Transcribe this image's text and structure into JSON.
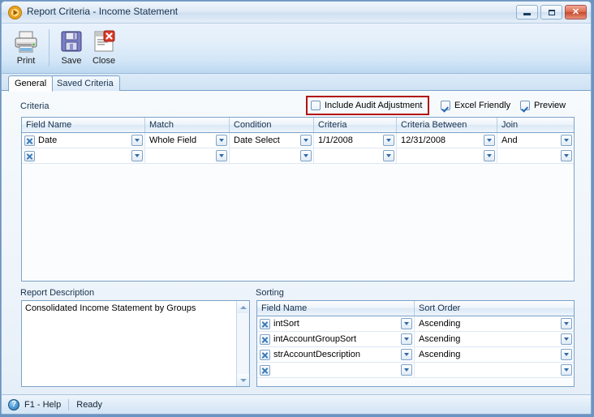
{
  "window": {
    "title": "Report Criteria - Income Statement",
    "app_icon": "play-circle-icon",
    "controls": {
      "minimize": "minimize-button",
      "maximize": "maximize-button",
      "close": "close-button"
    }
  },
  "toolbar": {
    "buttons": [
      {
        "label": "Print",
        "icon": "printer-icon"
      },
      {
        "label": "Save",
        "icon": "floppy-disk-icon"
      },
      {
        "label": "Close",
        "icon": "document-close-icon"
      }
    ]
  },
  "tabs": [
    {
      "label": "General",
      "active": true
    },
    {
      "label": "Saved Criteria",
      "active": false
    }
  ],
  "options": {
    "include_audit_adjustment": {
      "label": "Include Audit Adjustment",
      "checked": false,
      "highlighted": true
    },
    "excel_friendly": {
      "label": "Excel Friendly",
      "checked": true
    },
    "preview": {
      "label": "Preview",
      "checked": true
    }
  },
  "criteria": {
    "group_label": "Criteria",
    "columns": [
      "Field Name",
      "Match",
      "Condition",
      "Criteria",
      "Criteria Between",
      "Join"
    ],
    "rows": [
      {
        "field_name": "Date",
        "match": "Whole Field",
        "condition": "Date Select",
        "criteria": "1/1/2008",
        "criteria_between": "12/31/2008",
        "join": "And"
      },
      {
        "field_name": "",
        "match": "",
        "condition": "",
        "criteria": "",
        "criteria_between": "",
        "join": ""
      }
    ]
  },
  "report_description": {
    "label": "Report Description",
    "value": "Consolidated Income Statement by Groups"
  },
  "sorting": {
    "group_label": "Sorting",
    "columns": [
      "Field Name",
      "Sort Order"
    ],
    "rows": [
      {
        "field_name": "intSort",
        "sort_order": "Ascending"
      },
      {
        "field_name": "intAccountGroupSort",
        "sort_order": "Ascending"
      },
      {
        "field_name": "strAccountDescription",
        "sort_order": "Ascending"
      },
      {
        "field_name": "",
        "sort_order": ""
      }
    ]
  },
  "status_bar": {
    "help_icon": "question-mark-icon",
    "help_text": "F1 - Help",
    "state_text": "Ready"
  },
  "colors": {
    "accent": "#2f6bab",
    "highlight_border": "#b31212",
    "frame_border": "#7ba2c8"
  }
}
